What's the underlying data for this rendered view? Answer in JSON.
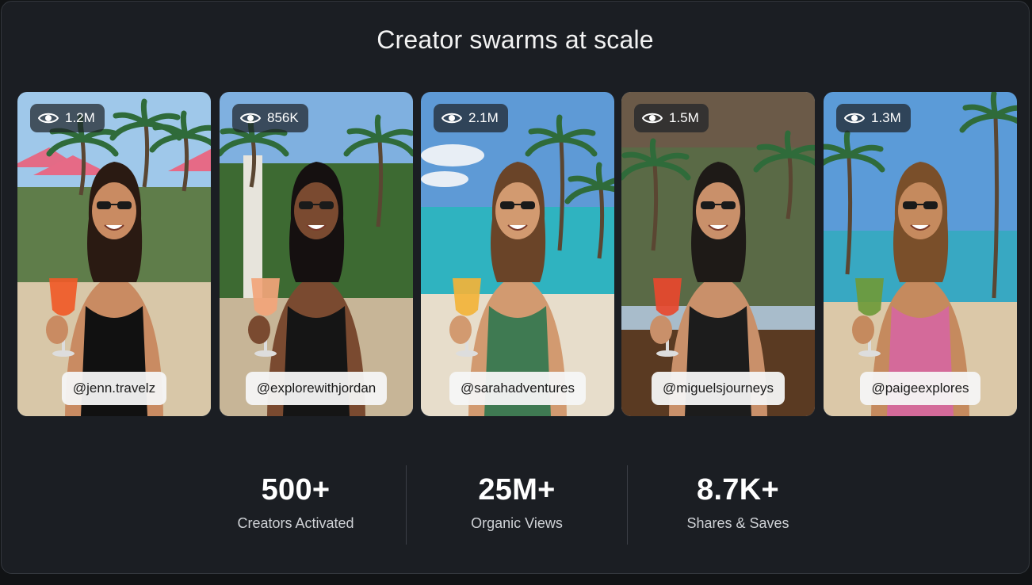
{
  "title": "Creator swarms at scale",
  "creators": [
    {
      "views": "1.2M",
      "handle": "@jenn.travelz",
      "drink": "#f05a28",
      "top": "#111111",
      "skin": "#c98b62",
      "hair": "#2a1a12",
      "bg": "umbrellas"
    },
    {
      "views": "856K",
      "handle": "@explorewithjordan",
      "drink": "#f2a57a",
      "top": "#151515",
      "skin": "#7a4a30",
      "hair": "#151010",
      "bg": "jungle"
    },
    {
      "views": "2.1M",
      "handle": "@sarahadventures",
      "drink": "#f3b33a",
      "top": "#3f7a52",
      "skin": "#d29a70",
      "hair": "#6a4428",
      "bg": "beach"
    },
    {
      "views": "1.5M",
      "handle": "@miguelsjourneys",
      "drink": "#e8482e",
      "top": "#1c1c1c",
      "skin": "#c9906a",
      "hair": "#1e1a17",
      "bg": "restaurant"
    },
    {
      "views": "1.3M",
      "handle": "@paigeexplores",
      "drink": "#6f9a3a",
      "top": "#d46a9a",
      "skin": "#c58a5e",
      "hair": "#7a4f2a",
      "bg": "palms"
    }
  ],
  "stats": [
    {
      "value": "500+",
      "label": "Creators Activated"
    },
    {
      "value": "25M+",
      "label": "Organic Views"
    },
    {
      "value": "8.7K+",
      "label": "Shares & Saves"
    }
  ]
}
